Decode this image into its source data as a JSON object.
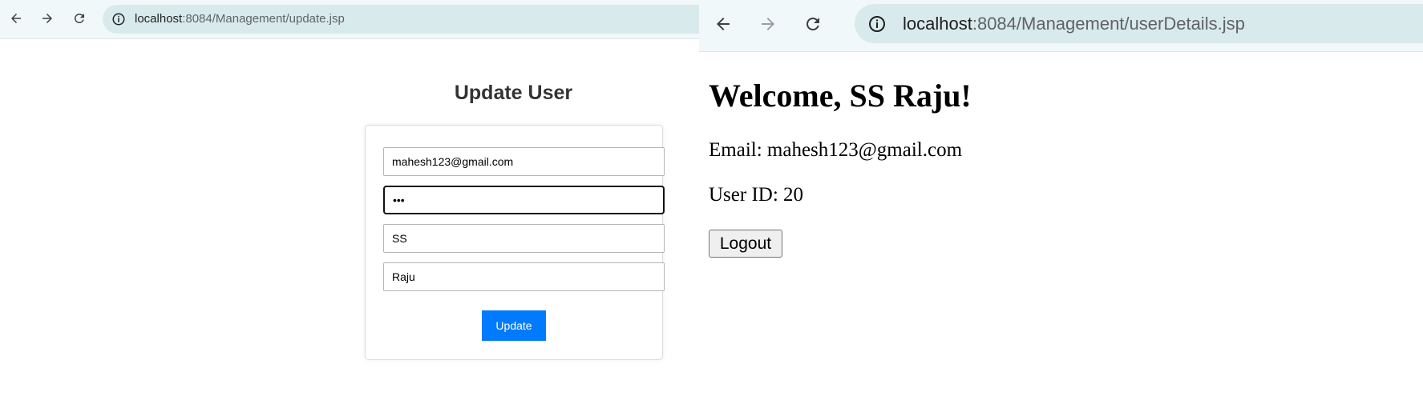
{
  "left_window": {
    "toolbar": {
      "back_icon": "arrow-left-icon",
      "forward_icon": "arrow-right-icon",
      "reload_icon": "reload-icon",
      "site_info_icon": "info-circle-icon",
      "url_host": "localhost",
      "url_path": ":8084/Management/update.jsp"
    },
    "form": {
      "title": "Update User",
      "email_value": "mahesh123@gmail.com",
      "password_value": "•••",
      "first_name_value": "SS",
      "last_name_value": "Raju",
      "update_label": "Update"
    }
  },
  "right_window": {
    "toolbar": {
      "back_icon": "arrow-left-icon",
      "forward_icon": "arrow-right-icon",
      "reload_icon": "reload-icon",
      "site_info_icon": "info-circle-icon",
      "url_host": "localhost",
      "url_path": ":8084/Management/userDetails.jsp"
    },
    "content": {
      "welcome": "Welcome, SS Raju!",
      "email_line": "Email: mahesh123@gmail.com",
      "user_id_line": "User ID: 20",
      "logout_label": "Logout"
    }
  },
  "colors": {
    "toolbar_bg": "#f1f8f9",
    "omnibox_bg": "#d9eaec",
    "update_button": "#007bff",
    "title_text": "#333333"
  }
}
